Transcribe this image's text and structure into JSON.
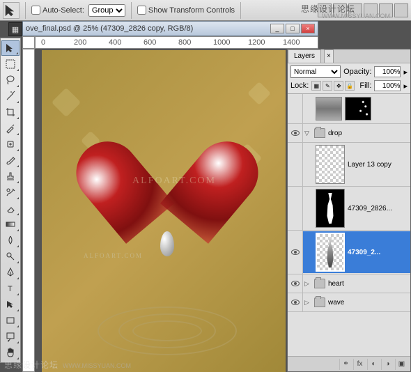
{
  "watermark": {
    "cn": "思缘设计论坛",
    "url": "WWW.MISSYUAN.COM",
    "canvas1": "ALFOART.COM",
    "canvas2": "ALFOART.COM"
  },
  "toolbar": {
    "auto_select_label": "Auto-Select:",
    "auto_select_value": "Group",
    "show_transform_label": "Show Transform Controls"
  },
  "document": {
    "title": "ove_final.psd @ 25% (47309_2826 copy, RGB/8)"
  },
  "ruler": {
    "marks": [
      "0",
      "200",
      "400",
      "600",
      "800",
      "1000",
      "1200",
      "1400"
    ]
  },
  "layers": {
    "tab": "Layers",
    "blend_mode": "Normal",
    "opacity_label": "Opacity:",
    "opacity_value": "100%",
    "lock_label": "Lock:",
    "fill_label": "Fill:",
    "fill_value": "100%",
    "items": [
      {
        "name": "drop",
        "type": "group",
        "expanded": true
      },
      {
        "name": "Layer 13 copy",
        "type": "layer"
      },
      {
        "name": "47309_2826...",
        "type": "layer"
      },
      {
        "name": "47309_2...",
        "type": "layer",
        "selected": true
      },
      {
        "name": "heart",
        "type": "group",
        "expanded": false
      },
      {
        "name": "wave",
        "type": "group",
        "expanded": false
      }
    ]
  }
}
